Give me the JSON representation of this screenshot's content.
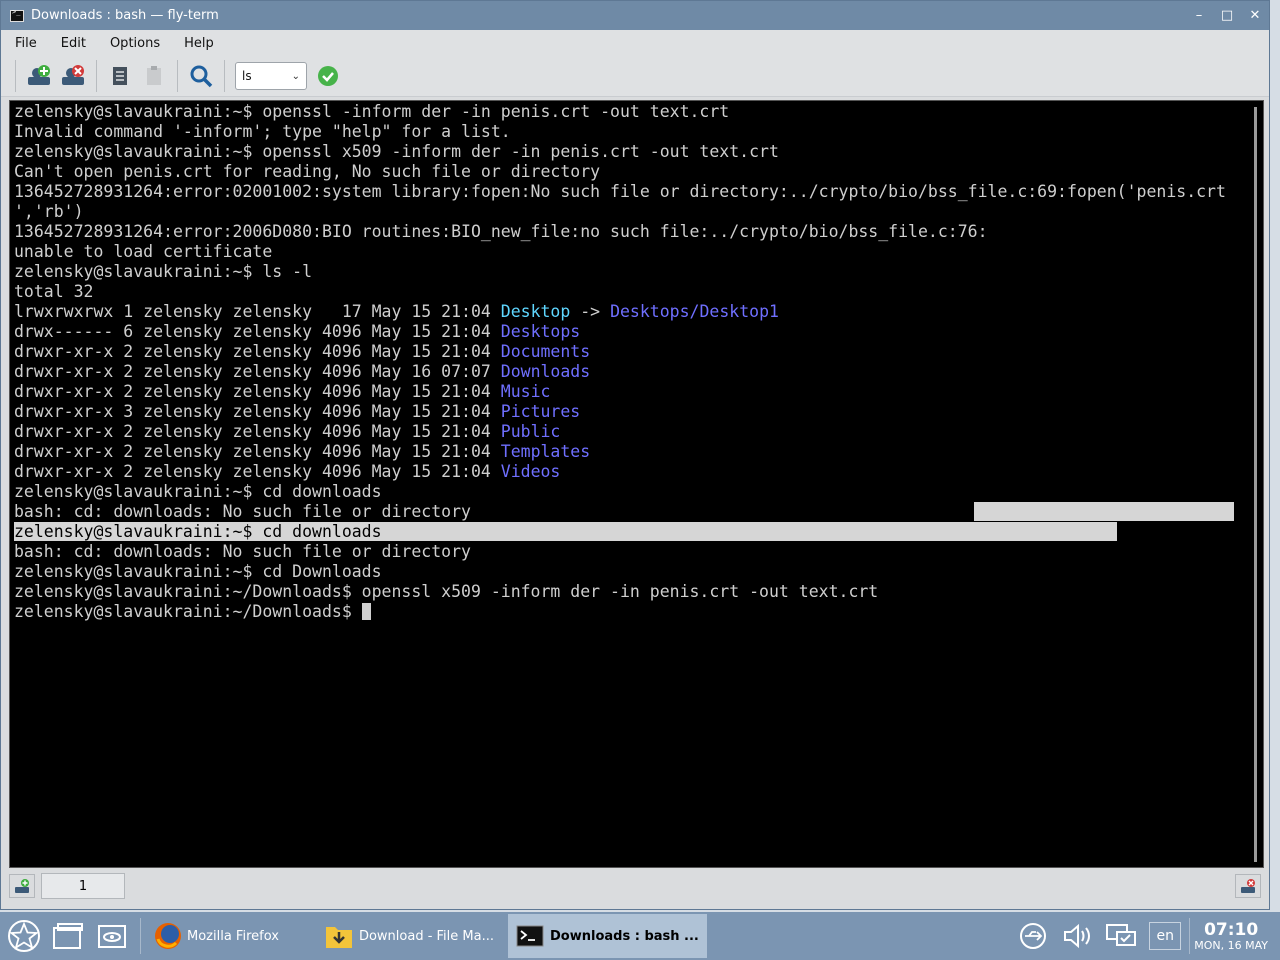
{
  "window": {
    "title": "Downloads : bash — fly-term",
    "min": "–",
    "max": "□",
    "close": "✕"
  },
  "menu": [
    "File",
    "Edit",
    "Options",
    "Help"
  ],
  "toolbar": {
    "command_select": "ls"
  },
  "terminal": {
    "lines": [
      [
        {
          "t": "zelensky@slavaukraini:~$ openssl -inform der -in penis.crt -out text.crt"
        }
      ],
      [
        {
          "t": "Invalid command '-inform'; type \"help\" for a list."
        }
      ],
      [
        {
          "t": "zelensky@slavaukraini:~$ openssl x509 -inform der -in penis.crt -out text.crt"
        }
      ],
      [
        {
          "t": "Can't open penis.crt for reading, No such file or directory"
        }
      ],
      [
        {
          "t": "136452728931264:error:02001002:system library:fopen:No such file or directory:../crypto/bio/bss_file.c:69:fopen('penis.crt"
        }
      ],
      [
        {
          "t": "','rb')"
        }
      ],
      [
        {
          "t": "136452728931264:error:2006D080:BIO routines:BIO_new_file:no such file:../crypto/bio/bss_file.c:76:"
        }
      ],
      [
        {
          "t": "unable to load certificate"
        }
      ],
      [
        {
          "t": "zelensky@slavaukraini:~$ ls -l"
        }
      ],
      [
        {
          "t": "total 32"
        }
      ],
      [
        {
          "t": "lrwxrwxrwx 1 zelensky zelensky   17 May 15 21:04 "
        },
        {
          "t": "Desktop",
          "c": "link"
        },
        {
          "t": " -> "
        },
        {
          "t": "Desktops/Desktop1",
          "c": "dir"
        }
      ],
      [
        {
          "t": "drwx------ 6 zelensky zelensky 4096 May 15 21:04 "
        },
        {
          "t": "Desktops",
          "c": "dir"
        }
      ],
      [
        {
          "t": "drwxr-xr-x 2 zelensky zelensky 4096 May 15 21:04 "
        },
        {
          "t": "Documents",
          "c": "dir"
        }
      ],
      [
        {
          "t": "drwxr-xr-x 2 zelensky zelensky 4096 May 16 07:07 "
        },
        {
          "t": "Downloads",
          "c": "dir"
        }
      ],
      [
        {
          "t": "drwxr-xr-x 2 zelensky zelensky 4096 May 15 21:04 "
        },
        {
          "t": "Music",
          "c": "dir"
        }
      ],
      [
        {
          "t": "drwxr-xr-x 3 zelensky zelensky 4096 May 15 21:04 "
        },
        {
          "t": "Pictures",
          "c": "dir"
        }
      ],
      [
        {
          "t": "drwxr-xr-x 2 zelensky zelensky 4096 May 15 21:04 "
        },
        {
          "t": "Public",
          "c": "dir"
        }
      ],
      [
        {
          "t": "drwxr-xr-x 2 zelensky zelensky 4096 May 15 21:04 "
        },
        {
          "t": "Templates",
          "c": "dir"
        }
      ],
      [
        {
          "t": "drwxr-xr-x 2 zelensky zelensky 4096 May 15 21:04 "
        },
        {
          "t": "Videos",
          "c": "dir"
        }
      ],
      [
        {
          "t": "zelensky@slavaukraini:~$ cd downloads"
        }
      ],
      [
        {
          "t": "bash: cd: downloads: No such file or directory"
        }
      ],
      [
        {
          "t": "zelensky@slavaukraini:~$ cd downloads                                                                          ",
          "c": "hl"
        }
      ],
      [
        {
          "t": "bash: cd: downloads: No such file or directory"
        }
      ],
      [
        {
          "t": "zelensky@slavaukraini:~$ cd Downloads"
        }
      ],
      [
        {
          "t": "zelensky@slavaukraini:~/Downloads$ openssl x509 -inform der -in penis.crt -out text.crt"
        }
      ],
      [
        {
          "t": "zelensky@slavaukraini:~/Downloads$ "
        },
        {
          "t": "",
          "c": "cursor"
        }
      ]
    ]
  },
  "tabbar": {
    "tab_label": "1"
  },
  "taskbar": {
    "tasks": [
      {
        "label": "Mozilla Firefox",
        "icon": "firefox-icon"
      },
      {
        "label": "Download - File Ma...",
        "icon": "folder-download-icon"
      },
      {
        "label": "Downloads : bash ...",
        "icon": "terminal-icon"
      }
    ],
    "lang": "en",
    "time": "07:10",
    "date": "MON, 16 MAY"
  }
}
